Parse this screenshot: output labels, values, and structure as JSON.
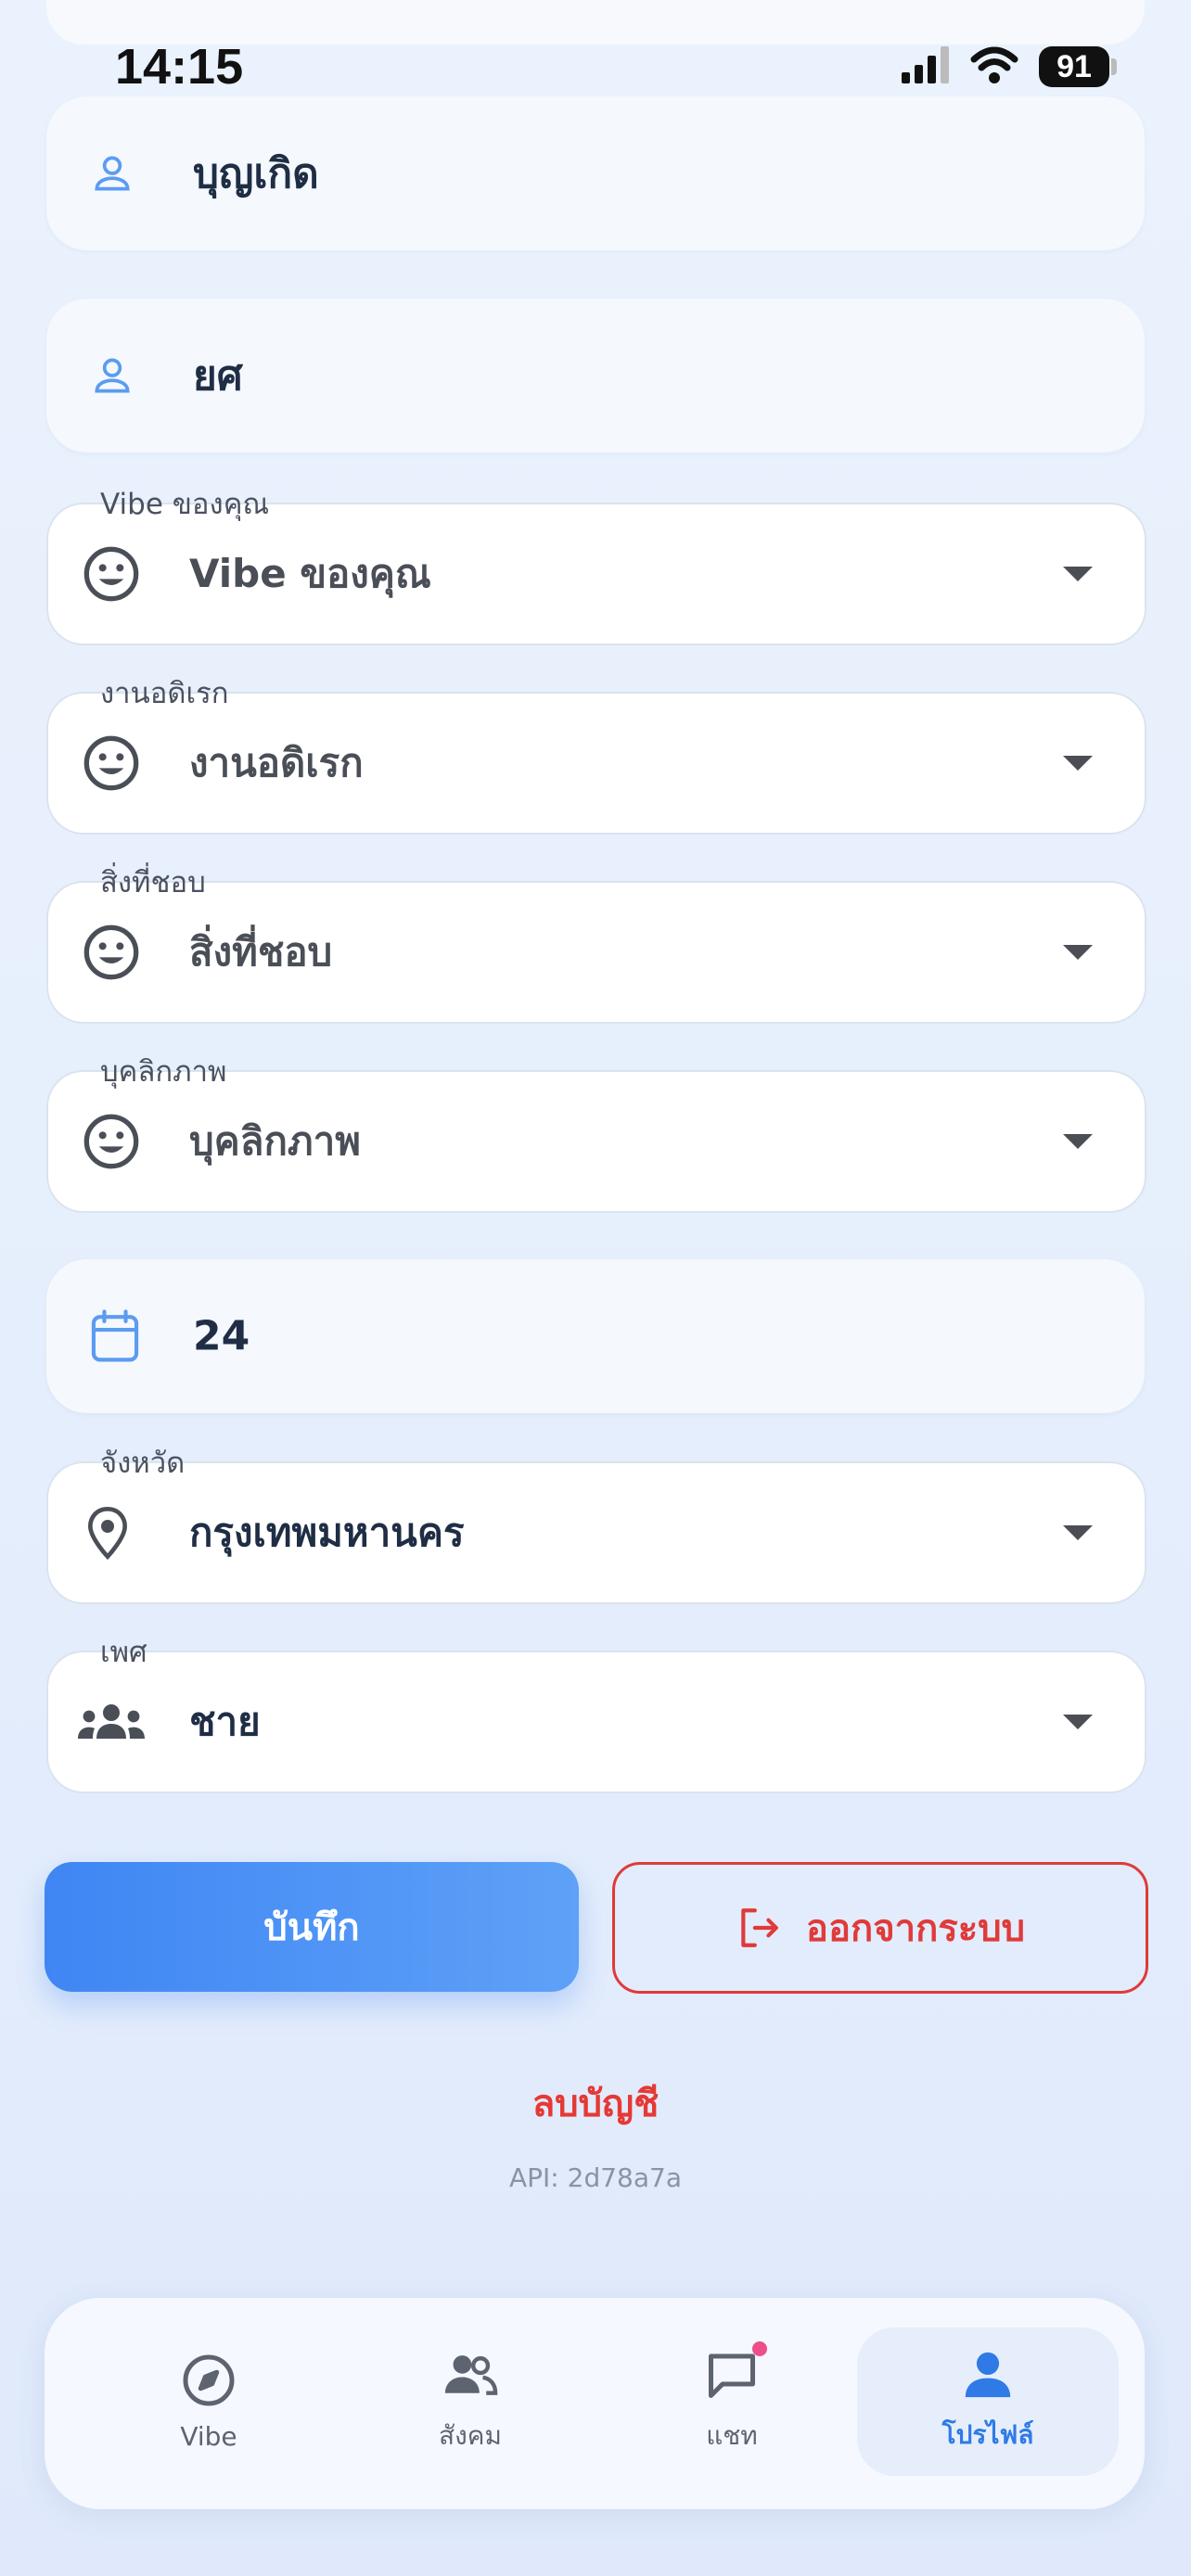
{
  "status_bar": {
    "time": "14:15",
    "battery": "91"
  },
  "fields": {
    "first_name": "บุญเกิด",
    "nickname": "ยศ",
    "age": "24"
  },
  "selects": {
    "vibe": {
      "label": "Vibe ของคุณ",
      "value": "Vibe ของคุณ"
    },
    "hobby": {
      "label": "งานอดิเรก",
      "value": "งานอดิเรก"
    },
    "likes": {
      "label": "สิ่งที่ชอบ",
      "value": "สิ่งที่ชอบ"
    },
    "personality": {
      "label": "บุคลิกภาพ",
      "value": "บุคลิกภาพ"
    },
    "province": {
      "label": "จังหวัด",
      "value": "กรุงเทพมหานคร"
    },
    "gender": {
      "label": "เพศ",
      "value": "ชาย"
    }
  },
  "actions": {
    "save_label": "บันทึก",
    "logout_label": "ออกจากระบบ",
    "delete_account_label": "ลบบัญชี",
    "api_version": "API: 2d78a7a"
  },
  "bottom_nav": {
    "items": [
      {
        "label": "Vibe",
        "icon": "compass-icon"
      },
      {
        "label": "สังคม",
        "icon": "people-icon"
      },
      {
        "label": "แชท",
        "icon": "chat-icon"
      },
      {
        "label": "โปรไฟล์",
        "icon": "person-icon"
      }
    ],
    "active_index": 3
  },
  "colors": {
    "primary": "#4289f4",
    "danger": "#e03a3a",
    "badge": "#ec4f8b"
  }
}
